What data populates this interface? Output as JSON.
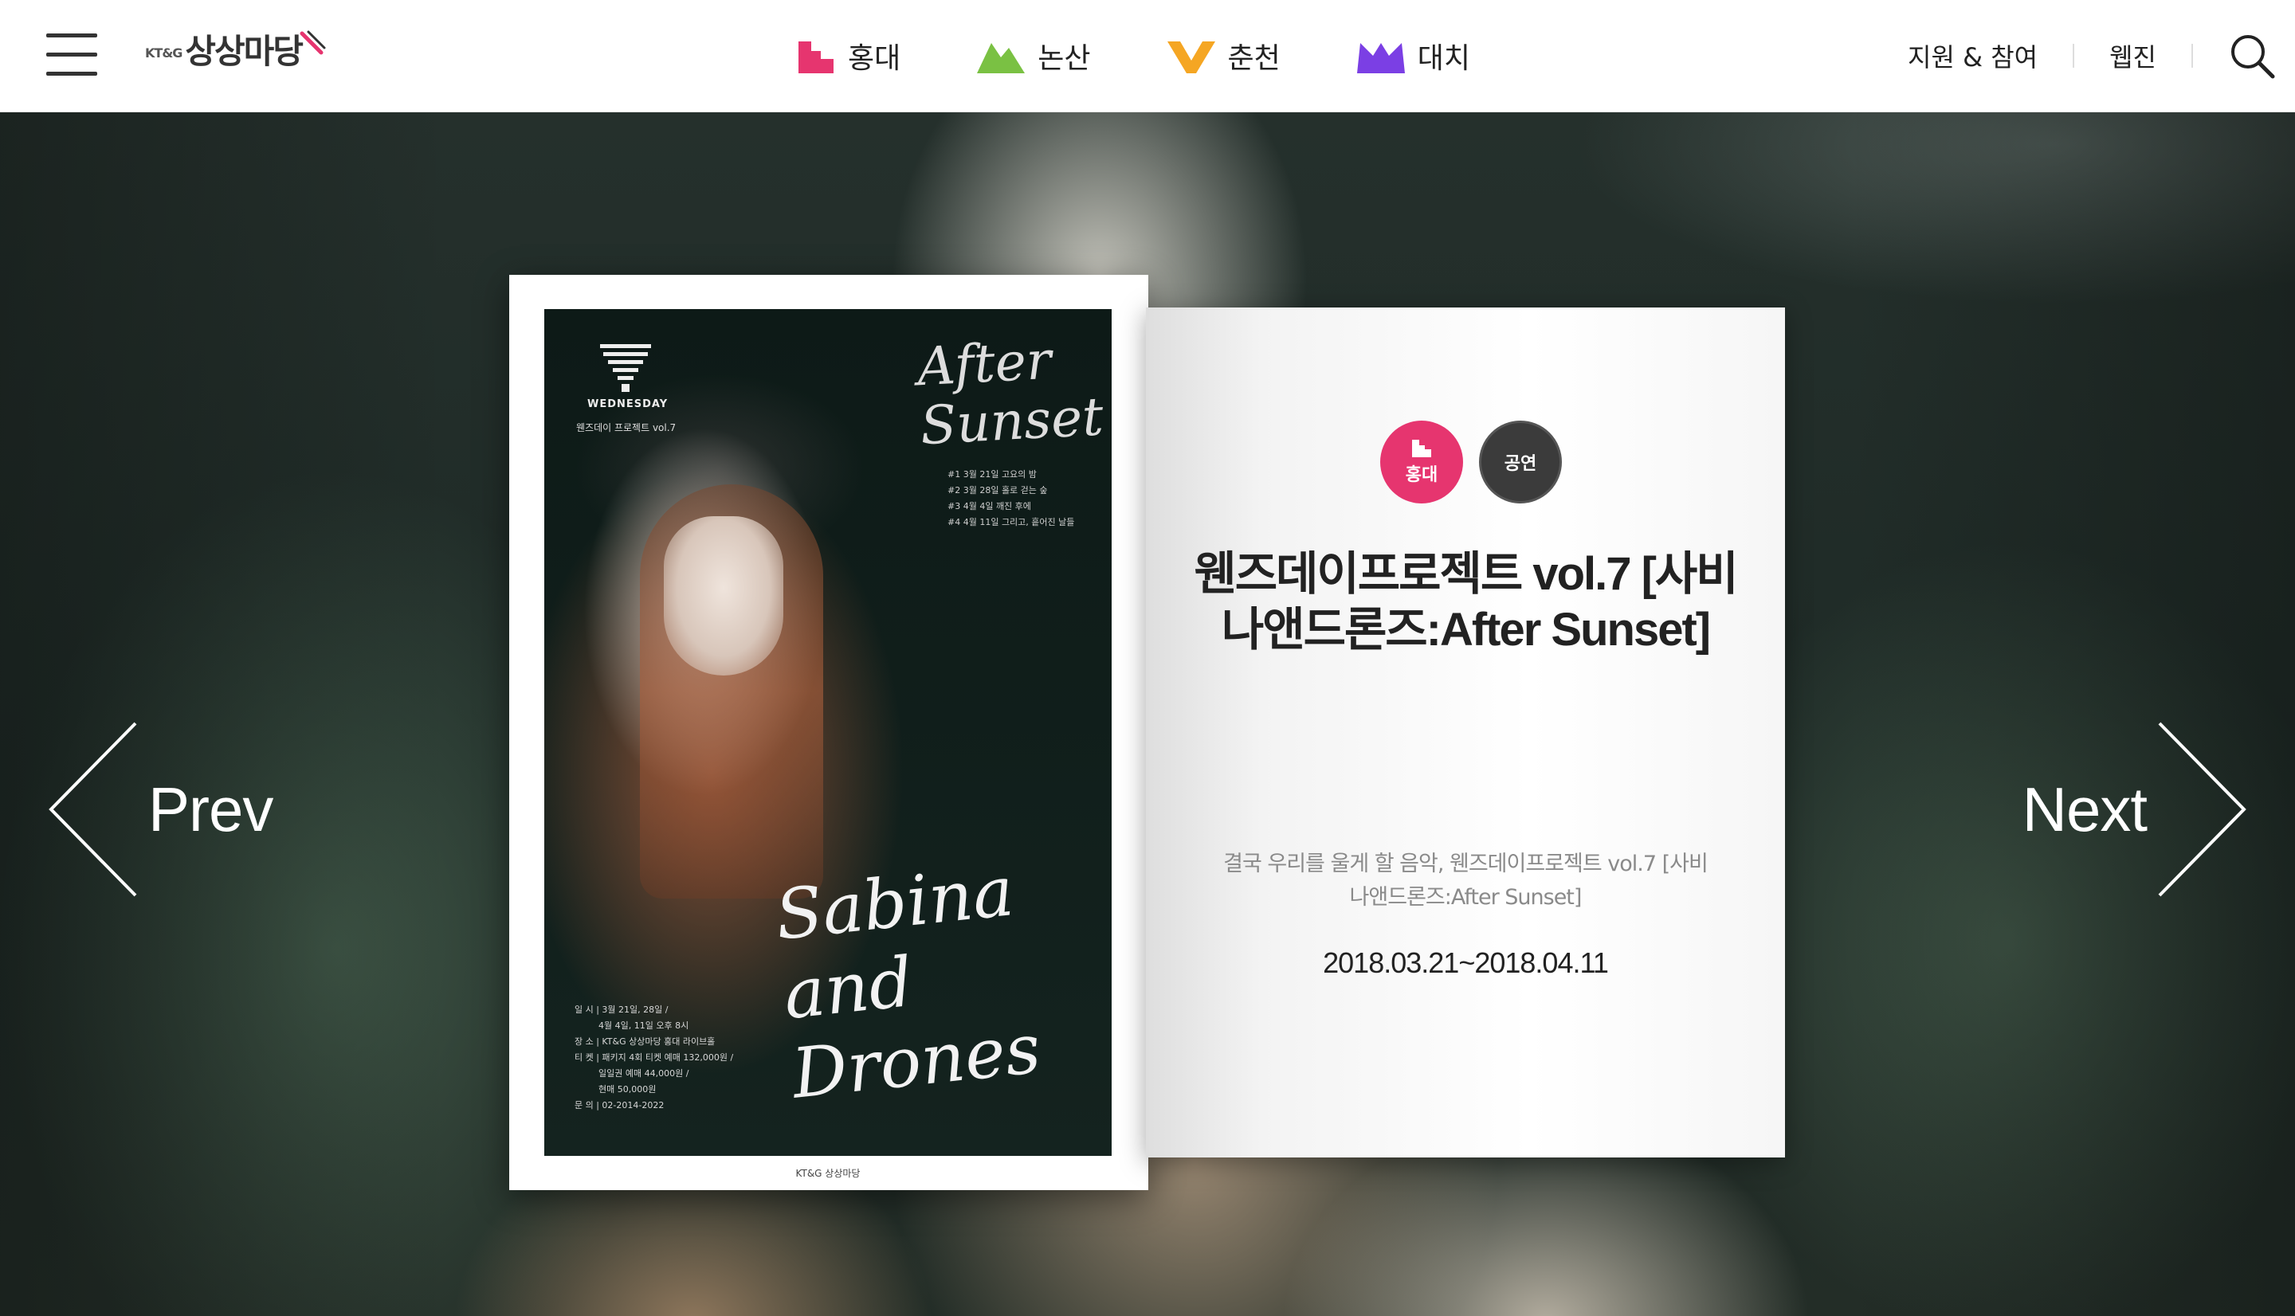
{
  "header": {
    "logo": {
      "small": "KT&G",
      "big": "상상마당"
    },
    "nav": [
      {
        "label": "홍대",
        "color": "#e6356f",
        "icon": "hongdae-stairs-icon"
      },
      {
        "label": "논산",
        "color": "#7ac143",
        "icon": "nonsan-mountain-icon"
      },
      {
        "label": "춘천",
        "color": "#f5a623",
        "icon": "chuncheon-v-icon"
      },
      {
        "label": "대치",
        "color": "#7b3fe4",
        "icon": "daechi-crown-icon"
      }
    ],
    "util": {
      "support": "지원 & 참여",
      "webzine": "웹진"
    }
  },
  "hero": {
    "prev": "Prev",
    "next": "Next",
    "card": {
      "badges": [
        {
          "label": "홍대",
          "color": "#e6356f"
        },
        {
          "label": "공연",
          "color": "#3b3b3b"
        }
      ],
      "title": "웬즈데이프로젝트 vol.7 [사비나앤드론즈:After Sunset]",
      "description": "결국 우리를 울게 할 음악, 웬즈데이프로젝트 vol.7 [사비나앤드론즈:After Sunset]",
      "date": "2018.03.21~2018.04.11"
    },
    "poster": {
      "wednesday": "WEDNESDAY",
      "subtitle": "웬즈데이 프로젝트 vol.7",
      "after_sunset": "After Sunset",
      "schedule": [
        "#1  3월 21일  고요의 밤",
        "#2  3월 28일  홀로 걷는 숲",
        "#3  4월 4일  깨진 후에",
        "#4  4월 11일  그리고, 흩어진 날들"
      ],
      "script": "Sabina and Drones",
      "info": [
        "일 시 | 3월 21일, 28일 /",
        "4월 4일, 11일 오후 8시",
        "장 소 | KT&G 상상마당 홍대 라이브홀",
        "티 켓 | 패키지 4회 티켓 예매 132,000원 /",
        "일일권 예매 44,000원 /",
        "현매 50,000원",
        "문 의 | 02-2014-2022"
      ],
      "footer": "KT&G 상상마당"
    }
  }
}
